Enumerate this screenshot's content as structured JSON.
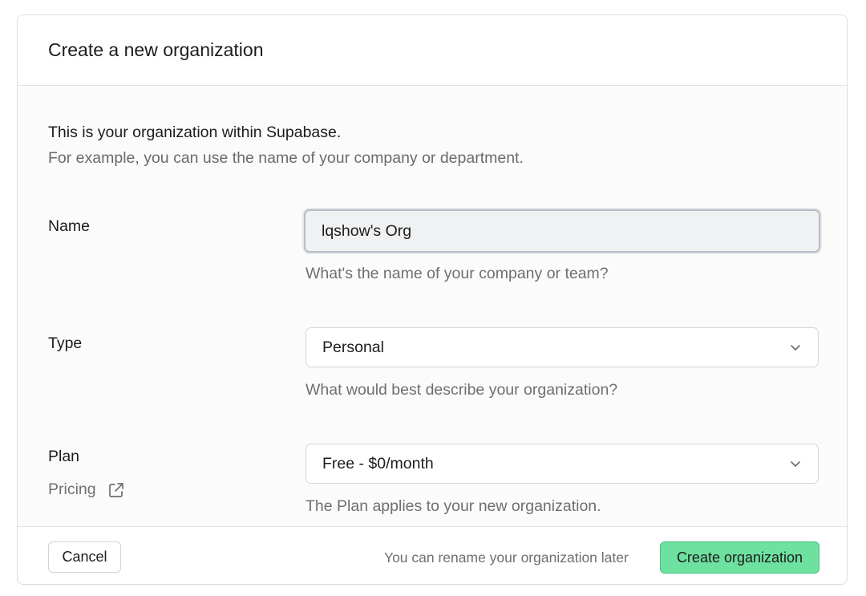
{
  "dialog": {
    "title": "Create a new organization",
    "intro_line1": "This is your organization within Supabase.",
    "intro_line2": "For example, you can use the name of your company or department."
  },
  "fields": {
    "name": {
      "label": "Name",
      "value": "lqshow's Org",
      "help": "What's the name of your company or team?"
    },
    "type": {
      "label": "Type",
      "selected": "Personal",
      "help": "What would best describe your organization?"
    },
    "plan": {
      "label": "Plan",
      "selected": "Free - $0/month",
      "pricing_link": "Pricing",
      "help": "The Plan applies to your new organization."
    }
  },
  "footer": {
    "cancel_label": "Cancel",
    "note": "You can rename your organization later",
    "create_label": "Create organization"
  },
  "colors": {
    "accent": "#6ee09f",
    "accent_border": "#3fc47f",
    "muted_text": "#6f6f6f"
  },
  "icons": {
    "select_chevron": "chevron-down-icon",
    "pricing": "external-link-icon"
  }
}
